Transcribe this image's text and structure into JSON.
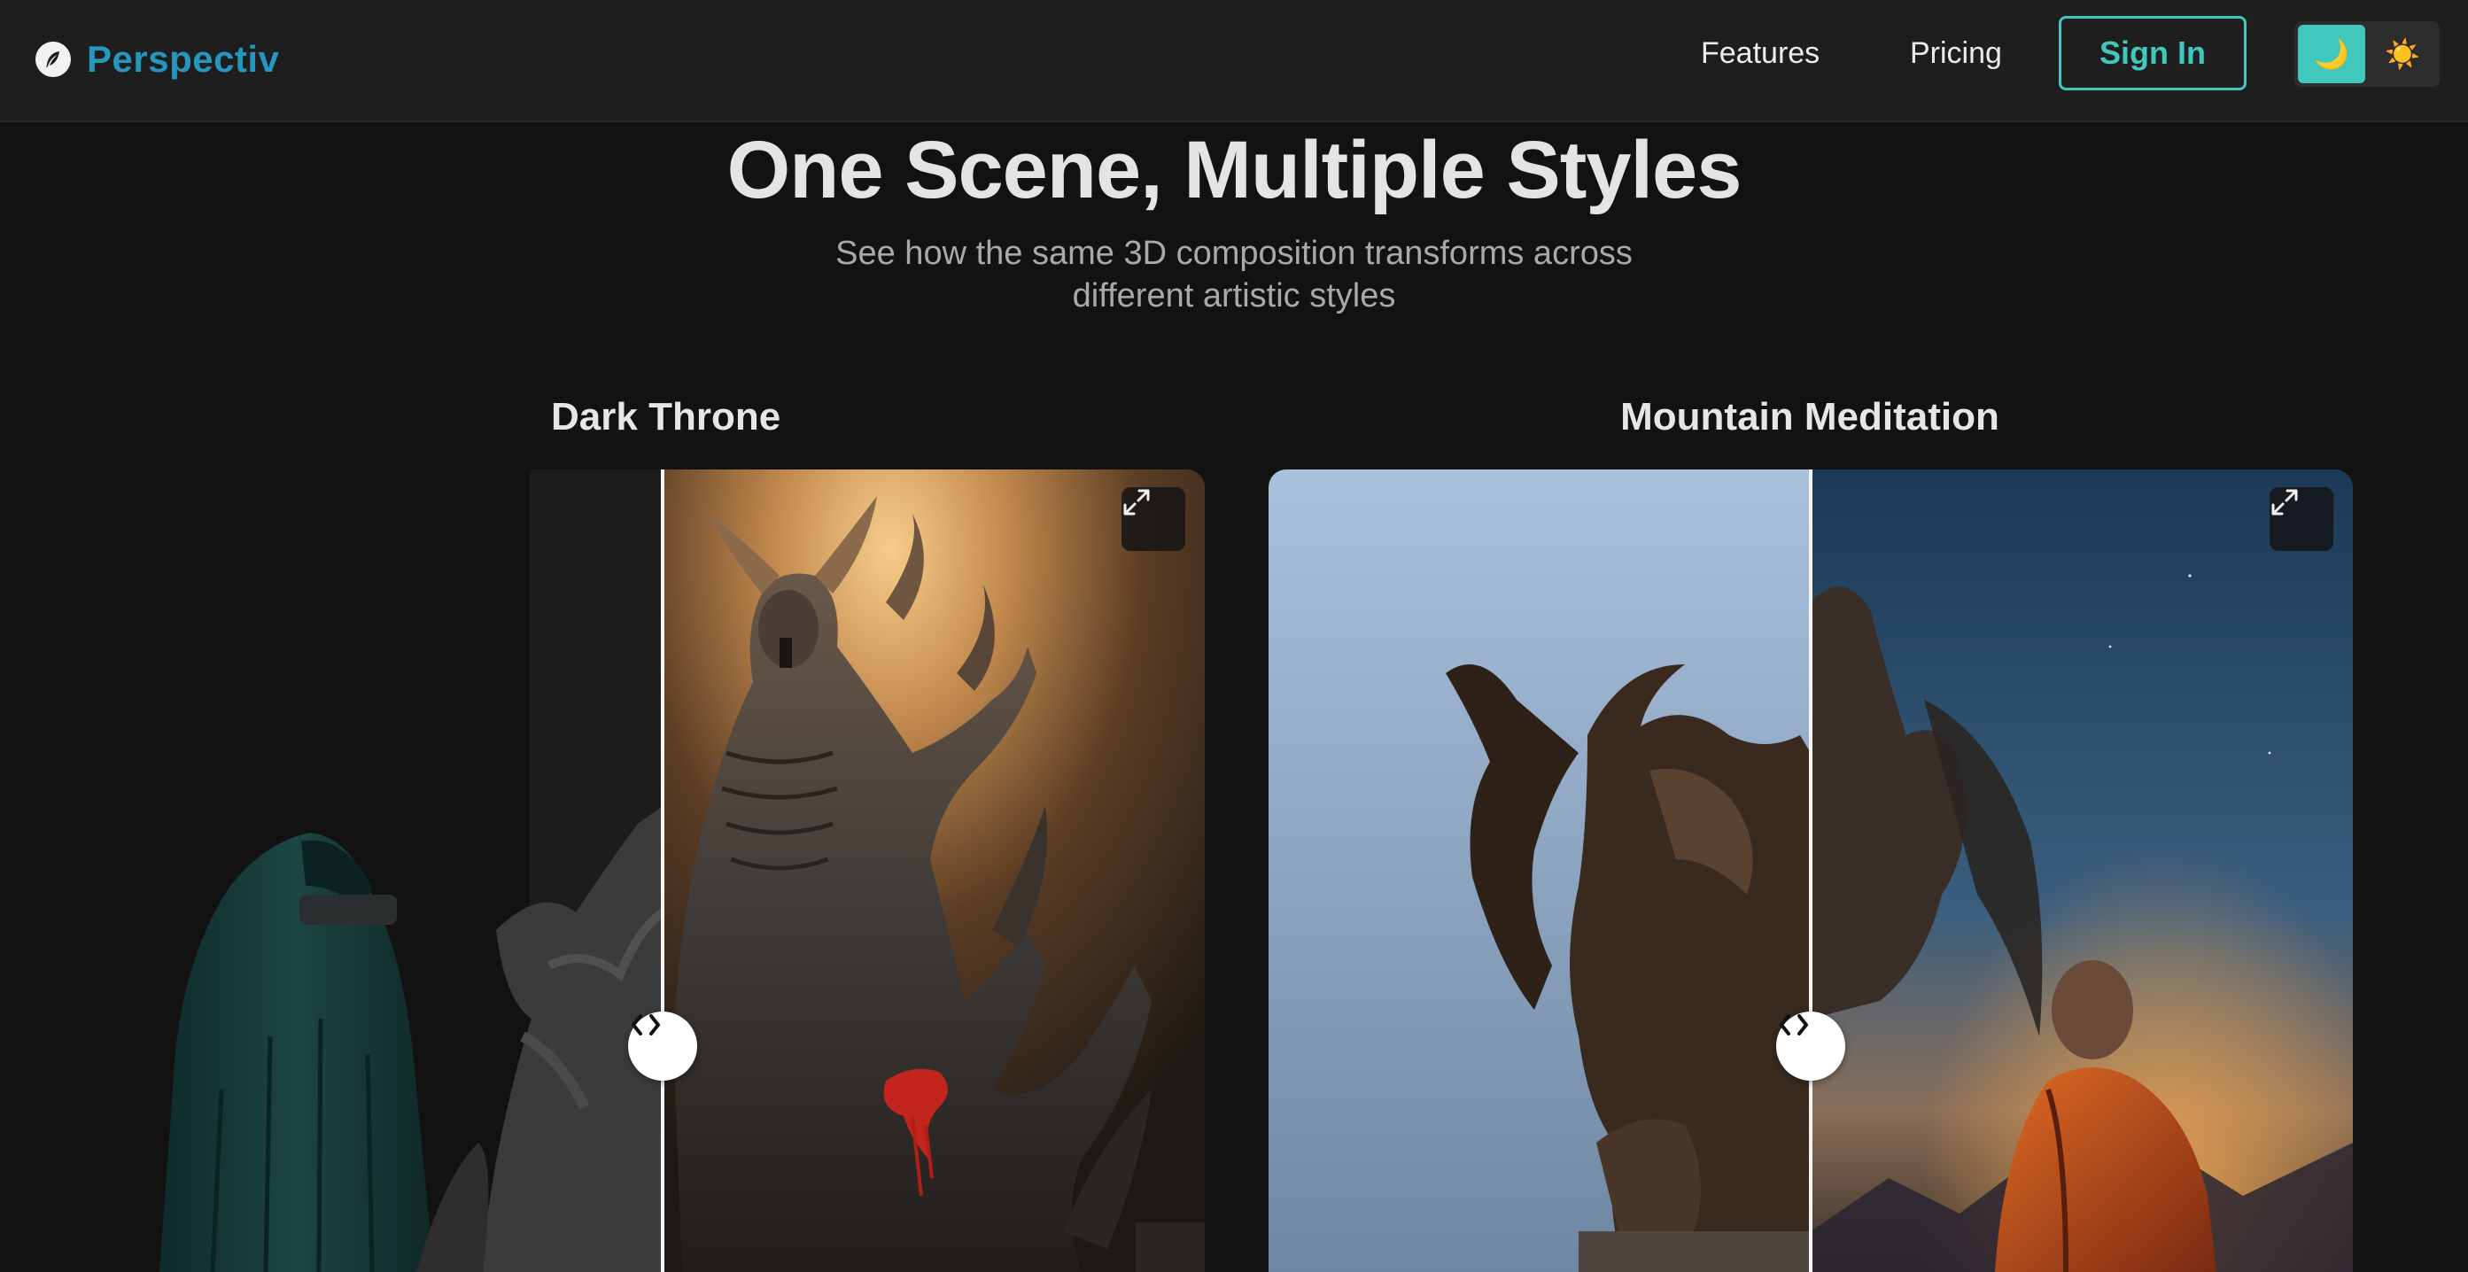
{
  "nav": {
    "brand": "Perspectiv",
    "brand_icon": "feather-icon",
    "links": [
      {
        "label": "Features"
      },
      {
        "label": "Pricing"
      }
    ],
    "signin_label": "Sign In",
    "theme": {
      "options": [
        {
          "icon": "moon-icon",
          "glyph": "🌙",
          "active": true
        },
        {
          "icon": "sun-icon",
          "glyph": "☀️",
          "active": false
        }
      ]
    }
  },
  "hero": {
    "title": "One Scene, Multiple Styles",
    "subtitle_line1": "See how the same 3D composition transforms across",
    "subtitle_line2": "different artistic styles"
  },
  "comparisons": [
    {
      "title": "Dark Throne",
      "slider_position": 0.55
    },
    {
      "title": "Mountain Meditation",
      "slider_position": 0.5
    }
  ],
  "colors": {
    "accent": "#41c8bd",
    "brand": "#2596be",
    "background": "#121212",
    "nav_background": "#1e1e1e"
  }
}
